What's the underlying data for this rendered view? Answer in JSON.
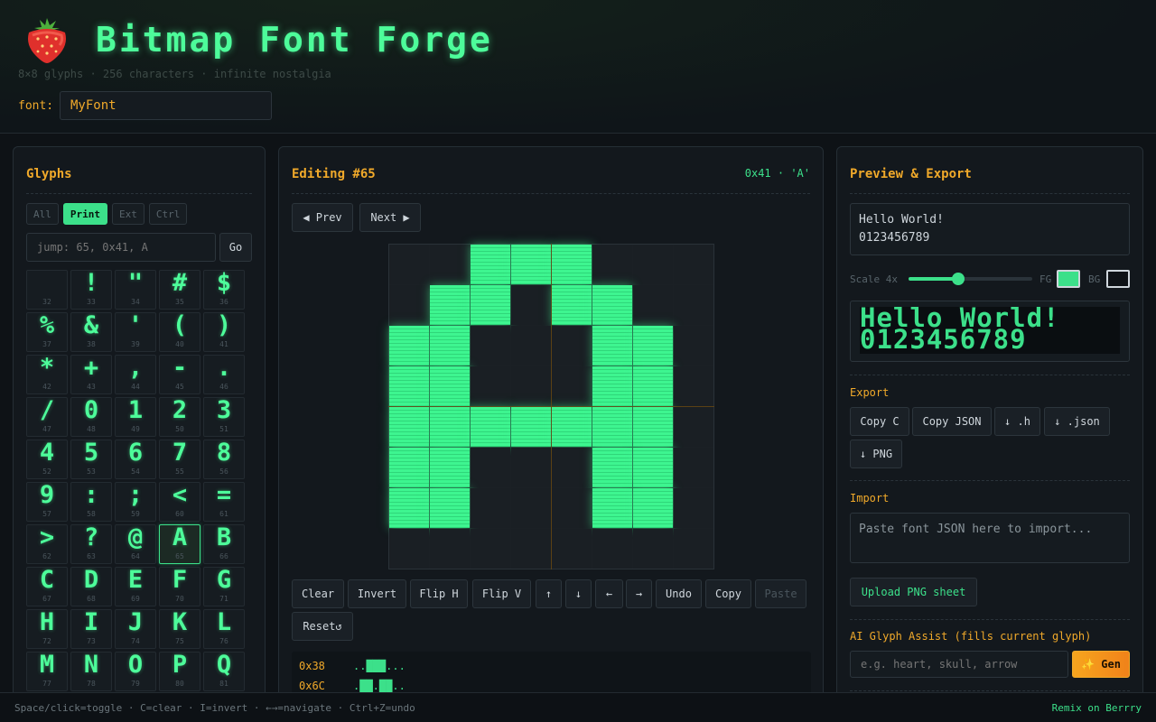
{
  "header": {
    "title": "Bitmap Font Forge",
    "subtitle": "8×8 glyphs · 256 characters · infinite nostalgia",
    "font_label": "font:",
    "font_name": "MyFont"
  },
  "glyphs_panel": {
    "title": "Glyphs",
    "tabs": [
      "All",
      "Print",
      "Ext",
      "Ctrl"
    ],
    "active_tab": "Print",
    "jump_placeholder": "jump: 65, 0x41, A",
    "go_label": "Go",
    "cells": [
      {
        "char": "",
        "code": "32"
      },
      {
        "char": "!",
        "code": "33"
      },
      {
        "char": "\"",
        "code": "34"
      },
      {
        "char": "#",
        "code": "35"
      },
      {
        "char": "$",
        "code": "36"
      },
      {
        "char": "%",
        "code": "37"
      },
      {
        "char": "&",
        "code": "38"
      },
      {
        "char": "'",
        "code": "39"
      },
      {
        "char": "(",
        "code": "40"
      },
      {
        "char": ")",
        "code": "41"
      },
      {
        "char": "*",
        "code": "42"
      },
      {
        "char": "+",
        "code": "43"
      },
      {
        "char": ",",
        "code": "44"
      },
      {
        "char": "-",
        "code": "45"
      },
      {
        "char": ".",
        "code": "46"
      },
      {
        "char": "/",
        "code": "47"
      },
      {
        "char": "0",
        "code": "48"
      },
      {
        "char": "1",
        "code": "49"
      },
      {
        "char": "2",
        "code": "50"
      },
      {
        "char": "3",
        "code": "51"
      },
      {
        "char": "4",
        "code": "52"
      },
      {
        "char": "5",
        "code": "53"
      },
      {
        "char": "6",
        "code": "54"
      },
      {
        "char": "7",
        "code": "55"
      },
      {
        "char": "8",
        "code": "56"
      },
      {
        "char": "9",
        "code": "57"
      },
      {
        "char": ":",
        "code": "58"
      },
      {
        "char": ";",
        "code": "59"
      },
      {
        "char": "<",
        "code": "60"
      },
      {
        "char": "=",
        "code": "61"
      },
      {
        "char": ">",
        "code": "62"
      },
      {
        "char": "?",
        "code": "63"
      },
      {
        "char": "@",
        "code": "64"
      },
      {
        "char": "A",
        "code": "65"
      },
      {
        "char": "B",
        "code": "66"
      },
      {
        "char": "C",
        "code": "67"
      },
      {
        "char": "D",
        "code": "68"
      },
      {
        "char": "E",
        "code": "69"
      },
      {
        "char": "F",
        "code": "70"
      },
      {
        "char": "G",
        "code": "71"
      },
      {
        "char": "H",
        "code": "72"
      },
      {
        "char": "I",
        "code": "73"
      },
      {
        "char": "J",
        "code": "74"
      },
      {
        "char": "K",
        "code": "75"
      },
      {
        "char": "L",
        "code": "76"
      },
      {
        "char": "M",
        "code": "77"
      },
      {
        "char": "N",
        "code": "78"
      },
      {
        "char": "O",
        "code": "79"
      },
      {
        "char": "P",
        "code": "80"
      },
      {
        "char": "Q",
        "code": "81"
      }
    ],
    "selected_code": "65"
  },
  "editor": {
    "title": "Editing #65",
    "char_info": "0x41 · 'A'",
    "prev_label": "◀ Prev",
    "next_label": "Next ▶",
    "bitmap": [
      "..###...",
      ".##.##..",
      "##...##.",
      "##...##.",
      "#######.",
      "##...##.",
      "##...##.",
      "........"
    ],
    "tools": [
      "Clear",
      "Invert",
      "Flip H",
      "Flip V",
      "↑",
      "↓",
      "←",
      "→",
      "Undo",
      "Copy",
      "Paste"
    ],
    "reset_label": "Reset↺",
    "hex_rows": [
      {
        "hex": "0x38",
        "bits": "..███..."
      },
      {
        "hex": "0x6C",
        "bits": ".██.██.."
      }
    ]
  },
  "preview": {
    "title": "Preview & Export",
    "text": "Hello World!\n0123456789",
    "line1": "Hello World!",
    "line2": "0123456789",
    "scale_label": "Scale 4x",
    "scale_value": 0.4,
    "fg_label": "FG",
    "bg_label": "BG",
    "fg_color": "#3ce08a",
    "bg_color": "#0e1216",
    "export_label": "Export",
    "export_buttons": [
      "Copy C",
      "Copy JSON",
      "↓ .h",
      "↓ .json",
      "↓ PNG"
    ],
    "import_label": "Import",
    "import_placeholder": "Paste font JSON here to import...",
    "upload_label": "Upload PNG sheet",
    "ai_label": "AI Glyph Assist (fills current glyph)",
    "ai_placeholder": "e.g. heart, skull, arrow",
    "gen_label": "✨ Gen"
  },
  "footer": {
    "help": "Space/click=toggle · C=clear · I=invert · ←→=navigate · Ctrl+Z=undo",
    "link": "Remix on Berrry"
  },
  "colors": {
    "accent": "#f0a92a",
    "green": "#3ce08a",
    "bg": "#0e1216"
  }
}
